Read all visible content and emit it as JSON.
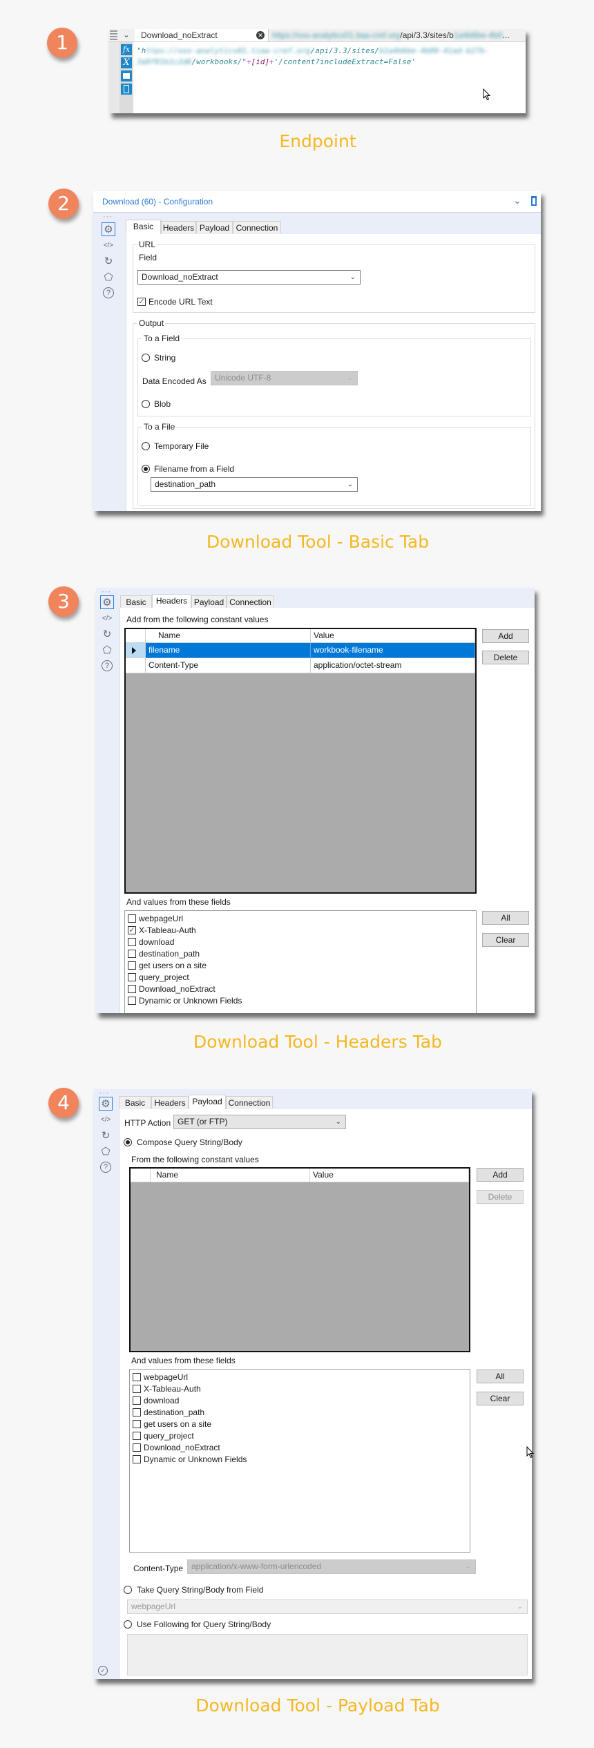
{
  "badges": [
    "1",
    "2",
    "3",
    "4"
  ],
  "captions": {
    "endpoint": "Endpoint",
    "basic": "Download Tool - Basic Tab",
    "headers": "Download Tool - Headers Tab",
    "payload": "Download Tool - Payload Tab"
  },
  "colors": {
    "background": "#f7f7f7",
    "badge": "#f0845c",
    "caption": "#f4b823",
    "selection": "#0078d7",
    "panel_strip": "#e9eef8",
    "code_text": "#2f8b97"
  },
  "endpoint": {
    "field_tab": "Download_noExtract",
    "url_preview": {
      "blurred_prefix": "https://xxx-analytics01.tiaa-cref.org",
      "visible": "/api/3.3/sites/b",
      "blurred_suffix": "1a4b6be-4b0",
      "ellipsis": "..."
    },
    "expression": {
      "line1": [
        "\"h",
        "ttps://xxx-analytics01.tiaa-cref.org",
        "/api/3.3/sites/",
        "b1a4b6be-4b09-41ad-b27b-"
      ],
      "line2": [
        "3a9f81b1c2d6",
        "/workbooks/\"",
        "+",
        "[id]",
        "+",
        "'/content?includeExtract=False'"
      ]
    },
    "toolbar_icons": [
      "fx-icon",
      "variable-x-icon",
      "folder-icon",
      "device-icon"
    ]
  },
  "tabs": [
    "Basic",
    "Headers",
    "Payload",
    "Connection"
  ],
  "sidebar_icons": [
    "gear-icon",
    "code-icon",
    "circle-arrow-icon",
    "tag-icon",
    "help-icon"
  ],
  "basic": {
    "title": "Download (60) - Configuration",
    "url_group": "URL",
    "field_label": "Field",
    "field_value": "Download_noExtract",
    "encode_label": "Encode URL Text",
    "encode_checked": true,
    "output_group": "Output",
    "to_field_group": "To a Field",
    "string_label": "String",
    "data_encoded_label": "Data Encoded As",
    "data_encoded_value": "Unicode UTF-8",
    "blob_label": "Blob",
    "to_file_group": "To a File",
    "temp_file_label": "Temporary File",
    "filename_field_label": "Filename from a Field",
    "filename_field_value": "destination_path",
    "selected_output": "filename_from_field"
  },
  "headers": {
    "constant_label": "Add from the following constant values",
    "columns": [
      "Name",
      "Value"
    ],
    "rows": [
      {
        "name": "filename",
        "value": "workbook-filename",
        "selected": true
      },
      {
        "name": "Content-Type",
        "value": "application/octet-stream",
        "selected": false
      }
    ],
    "add": "Add",
    "delete": "Delete",
    "fields_label": "And values from these fields",
    "fields": [
      {
        "label": "webpageUrl",
        "checked": false
      },
      {
        "label": "X-Tableau-Auth",
        "checked": true
      },
      {
        "label": "download",
        "checked": false
      },
      {
        "label": "destination_path",
        "checked": false
      },
      {
        "label": "get users on a site",
        "checked": false
      },
      {
        "label": "query_project",
        "checked": false
      },
      {
        "label": "Download_noExtract",
        "checked": false
      },
      {
        "label": "Dynamic or Unknown Fields",
        "checked": false
      }
    ],
    "all": "All",
    "clear": "Clear"
  },
  "payload": {
    "http_action_label": "HTTP Action",
    "http_action_value": "GET (or FTP)",
    "compose_label": "Compose Query String/Body",
    "constant_label": "From the following constant values",
    "columns": [
      "Name",
      "Value"
    ],
    "add": "Add",
    "delete": "Delete",
    "fields_label": "And values from these fields",
    "fields": [
      {
        "label": "webpageUrl",
        "checked": false
      },
      {
        "label": "X-Tableau-Auth",
        "checked": false
      },
      {
        "label": "download",
        "checked": false
      },
      {
        "label": "destination_path",
        "checked": false
      },
      {
        "label": "get users on a site",
        "checked": false
      },
      {
        "label": "query_project",
        "checked": false
      },
      {
        "label": "Download_noExtract",
        "checked": false
      },
      {
        "label": "Dynamic or Unknown Fields",
        "checked": false
      }
    ],
    "all": "All",
    "clear": "Clear",
    "content_type_label": "Content-Type",
    "content_type_value": "application/x-www-form-urlencoded",
    "take_from_field_label": "Take Query String/Body from Field",
    "take_from_field_value": "webpageUrl",
    "use_following_label": "Use Following for Query String/Body",
    "selected_mode": "compose"
  }
}
